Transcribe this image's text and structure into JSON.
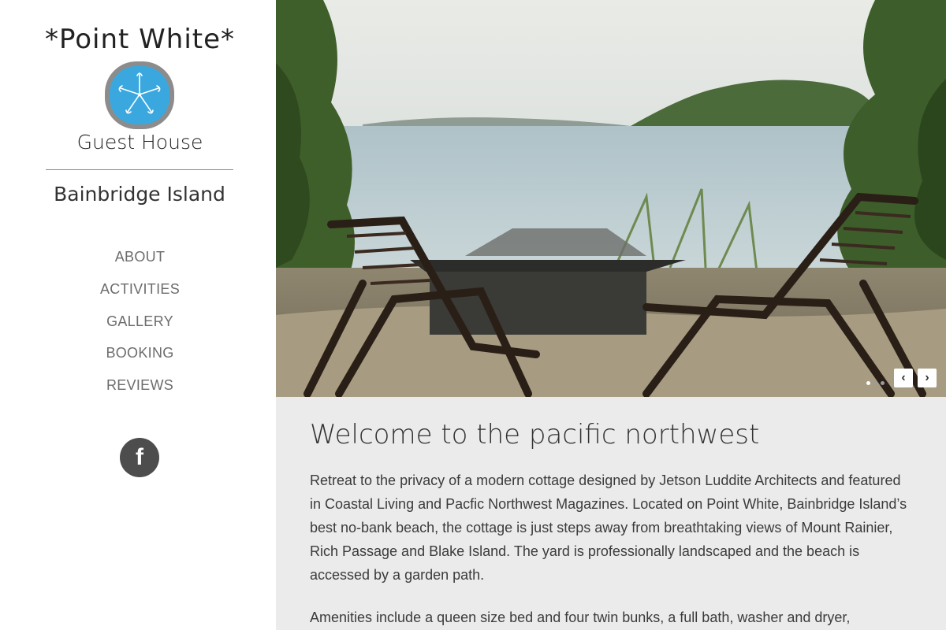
{
  "brand": {
    "name_line1": "*Point White*",
    "name_line2": "Guest House",
    "location": "Bainbridge Island"
  },
  "nav": {
    "items": [
      "ABOUT",
      "ACTIVITIES",
      "GALLERY",
      "BOOKING",
      "REVIEWS"
    ]
  },
  "social": {
    "facebook_glyph": "f"
  },
  "slider": {
    "total_slides": 3,
    "active_slide": 1,
    "prev_glyph": "‹",
    "next_glyph": "›"
  },
  "content": {
    "heading": "Welcome to the pacific northwest",
    "paragraph1": "Retreat to the privacy of a modern cottage designed by Jetson Luddite Architects and featured in Coastal Living and Pacfic Northwest Magazines. Located on Point White, Bainbridge Island’s best no-bank beach, the cottage is just steps away from breathtaking views of Mount Rainier, Rich Passage and Blake Island. The yard is professionally landscaped and the beach is accessed by a garden path.",
    "paragraph2": "Amenities include a queen size bed and four twin bunks, a full bath, washer and dryer,"
  },
  "colors": {
    "sidebar_bg": "#ffffff",
    "content_bg": "#ebebeb",
    "nav_text": "#6c6c6c",
    "logo_blue": "#3aa8df",
    "facebook_bg": "#4d4d4d"
  },
  "icons": {
    "logo": "sand-dollar-icon",
    "social": "facebook-icon",
    "prev": "chevron-left-icon",
    "next": "chevron-right-icon"
  }
}
